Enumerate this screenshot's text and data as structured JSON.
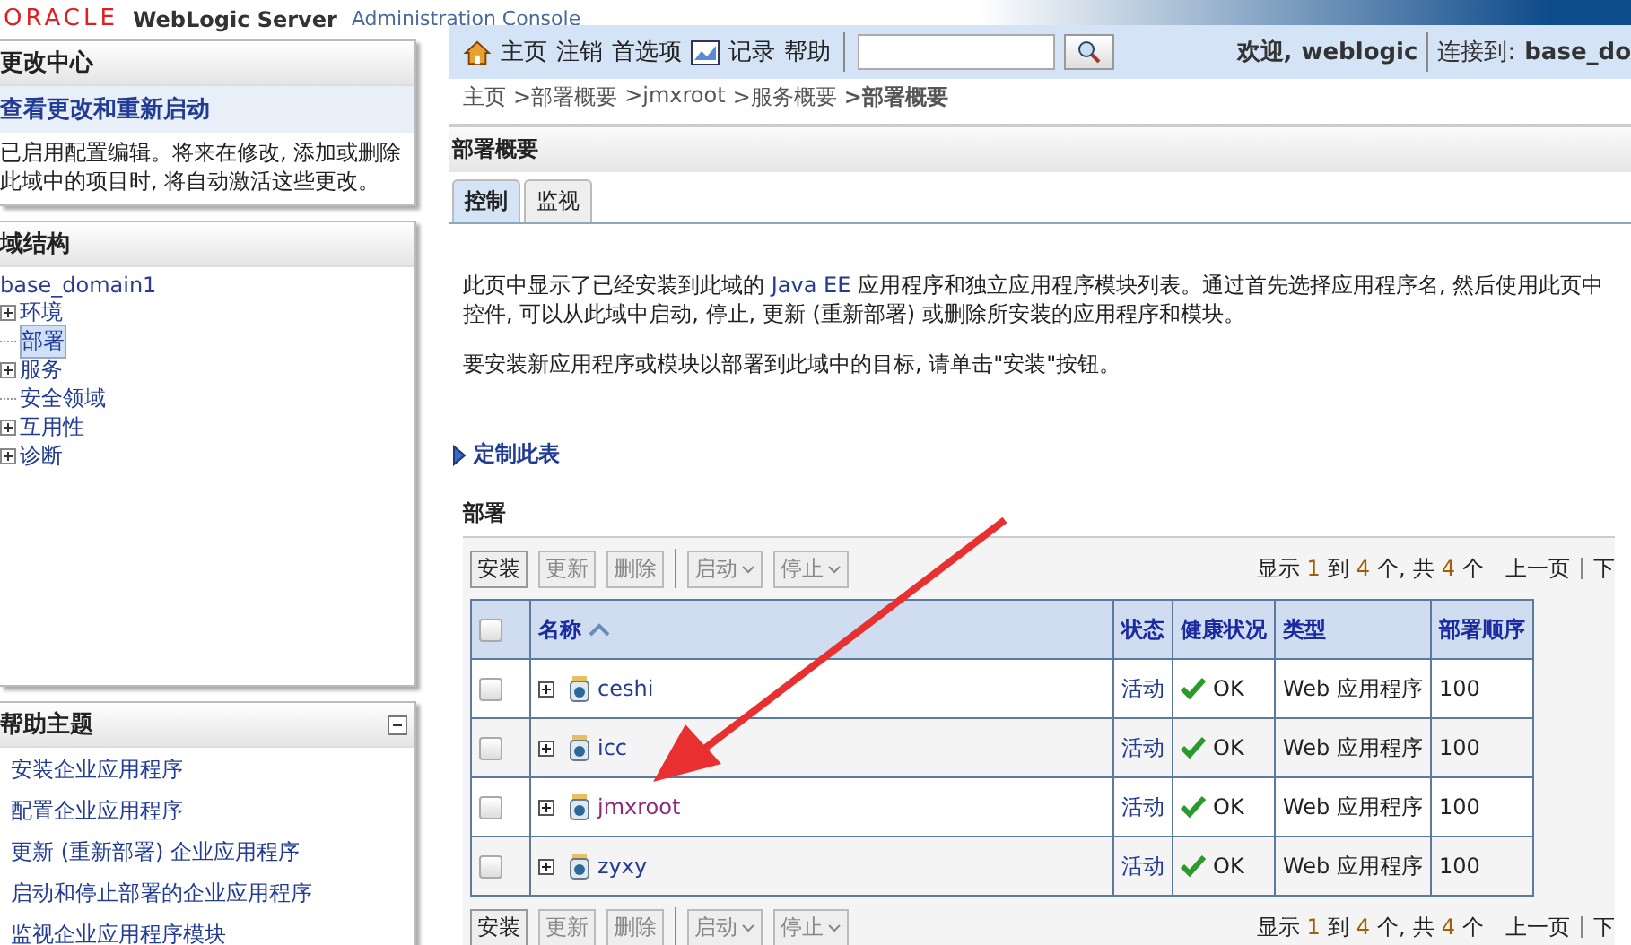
{
  "header": {
    "brand": "ORACLE",
    "product": "WebLogic Server",
    "subtitle": "Administration Console"
  },
  "change_center": {
    "title": "更改中心",
    "link": "查看更改和重新启动",
    "text": "已启用配置编辑。将来在修改, 添加或删除此域中的项目时, 将自动激活这些更改。"
  },
  "domain_structure": {
    "title": "域结构",
    "root": "base_domain1",
    "children": [
      {
        "label": "环境",
        "has_children": true,
        "selected": false
      },
      {
        "label": "部署",
        "has_children": false,
        "selected": true
      },
      {
        "label": "服务",
        "has_children": true,
        "selected": false
      },
      {
        "label": "安全领域",
        "has_children": false,
        "selected": false
      },
      {
        "label": "互用性",
        "has_children": true,
        "selected": false
      },
      {
        "label": "诊断",
        "has_children": true,
        "selected": false
      }
    ]
  },
  "help_topics": {
    "title": "帮助主题",
    "items": [
      "安装企业应用程序",
      "配置企业应用程序",
      "更新 (重新部署) 企业应用程序",
      "启动和停止部署的企业应用程序",
      "监视企业应用程序模块"
    ]
  },
  "toolbar": {
    "items": [
      {
        "label": "主页",
        "kind": "home"
      },
      {
        "label": "注销",
        "kind": "text"
      },
      {
        "label": "首选项",
        "kind": "text"
      },
      {
        "label": "记录",
        "kind": "record"
      },
      {
        "label": "帮助",
        "kind": "text"
      }
    ],
    "welcome": "欢迎,",
    "user": "weblogic",
    "connected_label": "连接到:",
    "domain": "base_do"
  },
  "breadcrumb": [
    {
      "label": "主页",
      "current": false
    },
    {
      "label": ">部署概要",
      "current": false
    },
    {
      "label": ">jmxroot",
      "current": false
    },
    {
      "label": ">服务概要",
      "current": false
    },
    {
      "label": ">部署概要",
      "current": true
    }
  ],
  "panel": {
    "title": "部署概要",
    "tabs": [
      {
        "label": "控制",
        "selected": true
      },
      {
        "label": "监视",
        "selected": false
      }
    ]
  },
  "intro": {
    "before": "此页中显示了已经安装到此域的 ",
    "link": "Java EE",
    "after": " 应用程序和独立应用程序模块列表。通过首先选择应用程序名, 然后使用此页中控件, 可以从此域中启动, 停止, 更新 (重新部署) 或删除所安装的应用程序和模块。"
  },
  "install_hint": "要安装新应用程序或模块以部署到此域中的目标, 请单击\"安装\"按钮。",
  "customize": "定制此表",
  "section_title": "部署",
  "actions": [
    {
      "label": "安装",
      "kind": "button",
      "disabled": false
    },
    {
      "label": "更新",
      "kind": "button",
      "disabled": true
    },
    {
      "label": "删除",
      "kind": "button",
      "disabled": true
    },
    {
      "label": "启动",
      "kind": "menu",
      "disabled": true
    },
    {
      "label": "停止",
      "kind": "menu",
      "disabled": true
    }
  ],
  "pager": {
    "parts": [
      "显示",
      "1",
      "到",
      "4",
      "个,",
      "共",
      "4",
      "个"
    ],
    "prev": "上一页",
    "next": "下"
  },
  "bottom_actions": [
    {
      "label": "安装",
      "kind": "button",
      "disabled": false
    },
    {
      "label": "更新",
      "kind": "button",
      "disabled": true
    },
    {
      "label": "删除",
      "kind": "button",
      "disabled": true
    },
    {
      "label": "启动",
      "kind": "menu",
      "disabled": true
    },
    {
      "label": "停止",
      "kind": "menu",
      "disabled": true
    }
  ],
  "bottom_pager": {
    "parts": [
      "显示",
      "1",
      "到",
      "4",
      "个,",
      "共",
      "4",
      "个"
    ],
    "prev": "上一页",
    "next": "下"
  },
  "table": {
    "select_all": {
      "checked": false
    },
    "columns": [
      "名称",
      "状态",
      "健康状况",
      "类型",
      "部署顺序"
    ],
    "rows": [
      {
        "name": "ceshi",
        "state": "活动",
        "health": "OK",
        "type": "Web 应用程序",
        "order": "100",
        "checked": false,
        "visited": false
      },
      {
        "name": "icc",
        "state": "活动",
        "health": "OK",
        "type": "Web 应用程序",
        "order": "100",
        "checked": false,
        "visited": false
      },
      {
        "name": "jmxroot",
        "state": "活动",
        "health": "OK",
        "type": "Web 应用程序",
        "order": "100",
        "checked": false,
        "visited": true
      },
      {
        "name": "zyxy",
        "state": "活动",
        "health": "OK",
        "type": "Web 应用程序",
        "order": "100",
        "checked": false,
        "visited": false
      }
    ]
  }
}
